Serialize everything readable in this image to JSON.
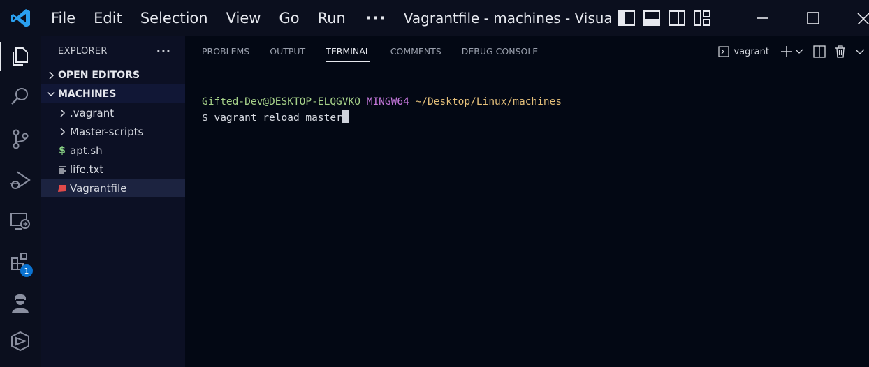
{
  "titlebar": {
    "menu": [
      "File",
      "Edit",
      "Selection",
      "View",
      "Go",
      "Run",
      "···"
    ],
    "window_title": "Vagrantfile - machines - Visual..."
  },
  "activitybar": {
    "items": [
      "explorer-icon",
      "search-icon",
      "source-control-icon",
      "run-debug-icon",
      "remote-explorer-icon",
      "extensions-icon",
      "account-icon",
      "docker-icon"
    ],
    "extensions_badge": "1"
  },
  "sidebar": {
    "title": "EXPLORER",
    "more": "···",
    "open_editors": "OPEN EDITORS",
    "folder": "MACHINES",
    "items": [
      {
        "label": ".vagrant",
        "kind": "folder"
      },
      {
        "label": "Master-scripts",
        "kind": "folder"
      },
      {
        "label": "apt.sh",
        "kind": "shell"
      },
      {
        "label": "life.txt",
        "kind": "text"
      },
      {
        "label": "Vagrantfile",
        "kind": "ruby"
      }
    ]
  },
  "panel": {
    "tabs": [
      "PROBLEMS",
      "OUTPUT",
      "TERMINAL",
      "COMMENTS",
      "DEBUG CONSOLE"
    ],
    "active_tab": "TERMINAL",
    "terminal_name": "vagrant"
  },
  "terminal": {
    "user": "Gifted-Dev@DESKTOP-ELQGVKO",
    "system": "MINGW64",
    "path": "~/Desktop/Linux/machines",
    "prompt": "$ ",
    "command": "vagrant reload master"
  },
  "colors": {
    "accent": "#0a72d0",
    "ruby": "#e04a4a",
    "shell": "#89d185"
  }
}
